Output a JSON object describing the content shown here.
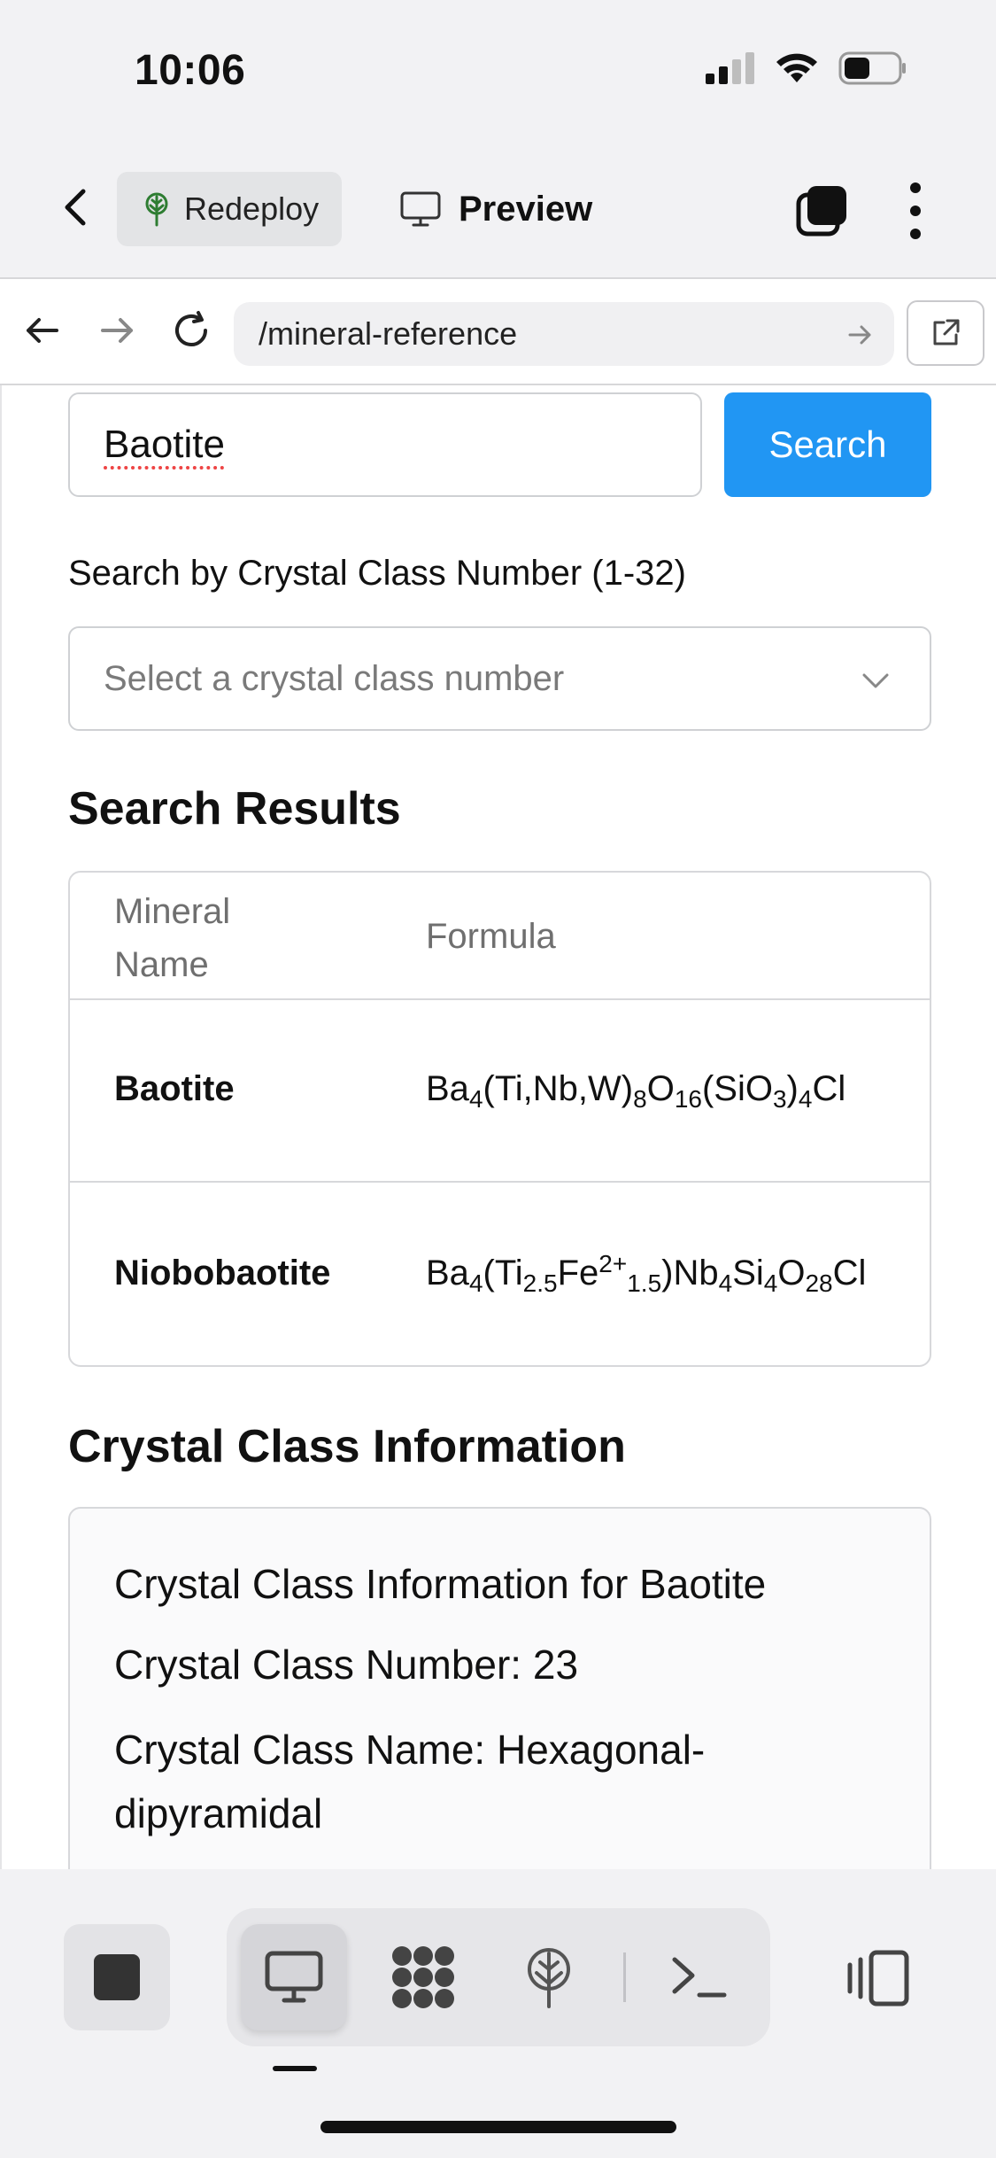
{
  "status_bar": {
    "time": "10:06"
  },
  "toolbar": {
    "redeploy_label": "Redeploy",
    "preview_label": "Preview"
  },
  "browser": {
    "url": "/mineral-reference"
  },
  "search": {
    "input_value": "Baotite",
    "button_label": "Search"
  },
  "crystal_search": {
    "label": "Search by Crystal Class Number (1-32)",
    "select_placeholder": "Select a crystal class number"
  },
  "results": {
    "title": "Search Results",
    "columns": [
      "Mineral Name",
      "Formula"
    ],
    "rows": [
      {
        "name": "Baotite",
        "formula_parts": [
          "Ba",
          "4",
          "(Ti,Nb,W)",
          "8",
          "O",
          "16",
          "(SiO",
          "3",
          ")",
          "4",
          "Cl"
        ]
      },
      {
        "name": "Niobobaotite",
        "formula_parts": [
          "Ba",
          "4",
          "(Ti",
          "2.5",
          "Fe",
          "2+",
          "",
          "1.5",
          ")Nb",
          "4",
          "Si",
          "4",
          "O",
          "28",
          "Cl"
        ]
      }
    ]
  },
  "crystal_info": {
    "title": "Crystal Class Information",
    "heading": "Crystal Class Information for Baotite",
    "number_label": "Crystal Class Number:",
    "number_value": "23",
    "name_label": "Crystal Class Name:",
    "name_value": "Hexagonal-dipyramidal"
  },
  "colors": {
    "accent": "#2196f3",
    "deploy_green": "#2e7d32"
  }
}
